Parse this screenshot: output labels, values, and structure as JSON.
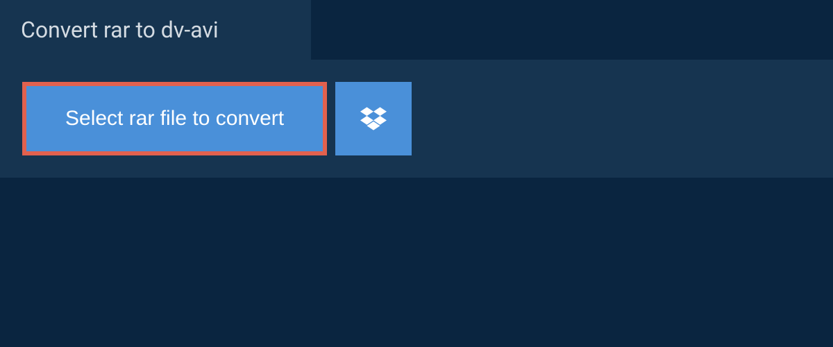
{
  "header": {
    "title": "Convert rar to dv-avi"
  },
  "actions": {
    "select_file_label": "Select rar file to convert"
  },
  "colors": {
    "background": "#0a2540",
    "panel": "#163450",
    "button": "#4a90d9",
    "highlight_border": "#e2614e",
    "text_light": "#d4dbe2",
    "text_white": "#ffffff"
  }
}
